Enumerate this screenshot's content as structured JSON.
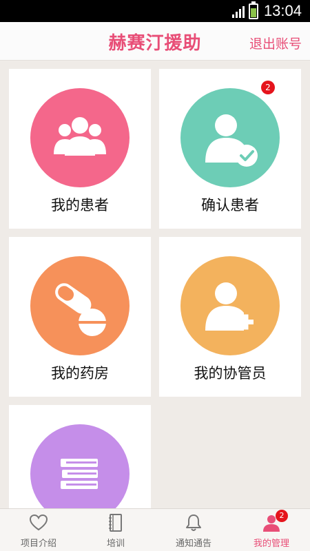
{
  "status_bar": {
    "time": "13:04"
  },
  "header": {
    "title": "赫赛汀援助",
    "logout_label": "退出账号"
  },
  "cards": [
    {
      "label": "我的患者",
      "icon": "group-icon",
      "color": "#f4678b",
      "badge": ""
    },
    {
      "label": "确认患者",
      "icon": "user-check-icon",
      "color": "#6dcdb6",
      "badge": "2"
    },
    {
      "label": "我的药房",
      "icon": "pills-icon",
      "color": "#f6915a",
      "badge": ""
    },
    {
      "label": "我的协管员",
      "icon": "user-add-icon",
      "color": "#f3b25d",
      "badge": ""
    },
    {
      "label": "",
      "icon": "books-icon",
      "color": "#c58ee9",
      "badge": ""
    }
  ],
  "tabbar": {
    "tabs": [
      {
        "label": "项目介绍",
        "icon": "heart-icon"
      },
      {
        "label": "培训",
        "icon": "notebook-icon"
      },
      {
        "label": "通知通告",
        "icon": "bell-icon"
      },
      {
        "label": "我的管理",
        "icon": "user-icon",
        "badge": "2",
        "active": true
      }
    ]
  },
  "colors": {
    "accent": "#e84e77",
    "badge": "#e5141c"
  }
}
